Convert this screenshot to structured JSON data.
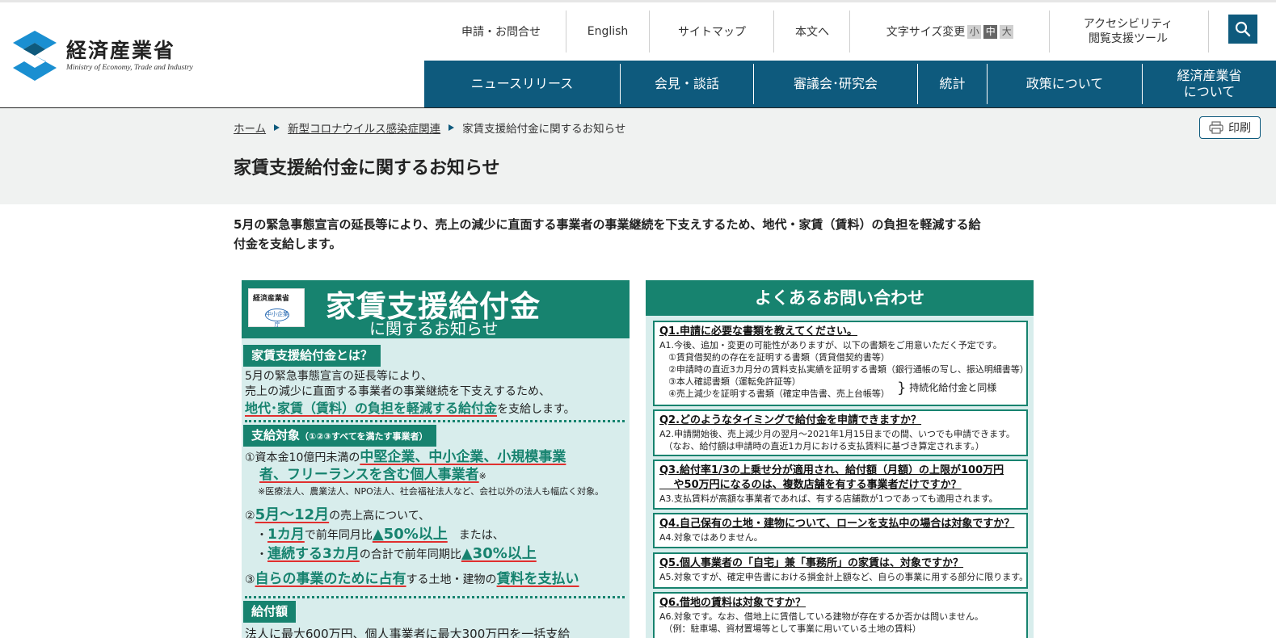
{
  "header": {
    "logo": {
      "jp": "経済産業省",
      "en": "Ministry of Economy, Trade and Industry"
    },
    "utility": {
      "contact": "申請・お問合せ",
      "english": "English",
      "sitemap": "サイトマップ",
      "skip_to_content": "本文へ",
      "font_size_label": "文字サイズ変更",
      "font_small": "小",
      "font_medium": "中",
      "font_large": "大",
      "accessibility_line1": "アクセシビリティ",
      "accessibility_line2": "閲覧支援ツール"
    },
    "nav": [
      {
        "label": "ニュースリリース"
      },
      {
        "label": "会見・談話"
      },
      {
        "label": "審議会･研究会"
      },
      {
        "label": "統計"
      },
      {
        "label": "政策について"
      },
      {
        "label_line1": "経済産業省",
        "label_line2": "について"
      }
    ]
  },
  "breadcrumb": {
    "home": "ホーム",
    "covid": "新型コロナウイルス感染症関連",
    "current": "家賃支援給付金に関するお知らせ"
  },
  "print_label": "印刷",
  "page_title": "家賃支援給付金に関するお知らせ",
  "intro": {
    "line1": "5月の緊急事態宣言の延長等により、売上の減少に直面する事業者の事業継続を下支えするため、地代・家賃（賃料）の負担を軽減する給",
    "line2": "付金を支給します。"
  },
  "flyer": {
    "logo_meti": "経済産業省",
    "logo_sme": "中小企業庁",
    "title": "家賃支援給付金",
    "subtitle": "に関するお知らせ",
    "what_tag": "家賃支援給付金とは？",
    "what_line1": "5月の緊急事態宣言の延長等により、",
    "what_line2": "売上の減少に直面する事業者の事業継続を下支えするため、",
    "what_line3_em": "地代･家賃（賃料）の負担を軽減する給付金",
    "what_line3_rest": "を支給します。",
    "target_tag": "支給対象",
    "target_tag_note": "（①②③すべてを満たす事業者）",
    "c1_prefix": "①資本金10億円未満の",
    "c1_em1": "中堅企業、中小企業、小規模事業",
    "c1_em2": "者、フリーランスを含む個人事業者",
    "c1_mark": "※",
    "c1_note": "※医療法人、農業法人、NPO法人、社会福祉法人など、会社以外の法人も幅広く対象。",
    "c2_num": "②",
    "c2_em": "5月～12月",
    "c2_rest": "の売上高について、",
    "c2a_bullet": "・",
    "c2a_em": "1カ月",
    "c2a_mid": "で前年同月比",
    "c2a_em2": "▲50%以上",
    "c2a_rest": "　または、",
    "c2b_bullet": "・",
    "c2b_em": "連続する3カ月",
    "c2b_mid": "の合計で前年同期比",
    "c2b_em2": "▲30%以上",
    "c3_num": "③",
    "c3_em": "自らの事業のために占有",
    "c3_mid": "する土地・建物の",
    "c3_em2": "賃料を支払い",
    "amount_tag": "給付額",
    "amount_line": "法人に最大600万円、個人事業者に最大300万円を一括支給"
  },
  "faq": {
    "title": "よくあるお問い合わせ",
    "items": [
      {
        "q": "Q1.申請に必要な書類を教えてください。",
        "a": [
          "A1.今後、追加・変更の可能性がありますが、以下の書類をご用意いただく予定です。",
          "　①賃貸借契約の存在を証明する書類（賃貸借契約書等）",
          "　②申請時の直近3カ月分の賃料支払実績を証明する書類（銀行通帳の写し、振込明細書等）",
          "　③本人確認書類（運転免許証等）",
          "　④売上減少を証明する書類（確定申告書、売上台帳等）"
        ],
        "side_note": "持続化給付金と同様"
      },
      {
        "q": "Q2.どのようなタイミングで給付金を申請できますか？",
        "a": [
          "A2.申請開始後、売上減少月の翌月～2021年1月15日までの間、いつでも申請できます。",
          "　（なお、給付額は申請時の直近1カ月における支払賃料に基づき算定されます。）"
        ]
      },
      {
        "q": "Q3.給付率1/3の上乗せ分が適用され、給付額（月額）の上限が100万円",
        "q2": "　 や50万円になるのは、複数店舗を有する事業者だけですか？",
        "a": [
          "A3.支払賃料が高額な事業者であれば、有する店舗数が1つであっても適用されます。"
        ]
      },
      {
        "q": "Q4.自己保有の土地・建物について、ローンを支払中の場合は対象ですか？",
        "a": [
          "A4.対象ではありません。"
        ]
      },
      {
        "q": "Q5.個人事業者の「自宅」兼「事務所」の家賃は、対象ですか？",
        "a": [
          "A5.対象ですが、確定申告書における損金計上額など、自らの事業に用する部分に限ります。"
        ]
      },
      {
        "q": "Q6.借地の賃料は対象ですか？",
        "a": [
          "A6.対象です。なお、借地上に賃借している建物が存在するか否かは問いません。",
          "　（例：駐車場、資材置場等として事業に用いている土地の賃料）"
        ]
      }
    ]
  }
}
